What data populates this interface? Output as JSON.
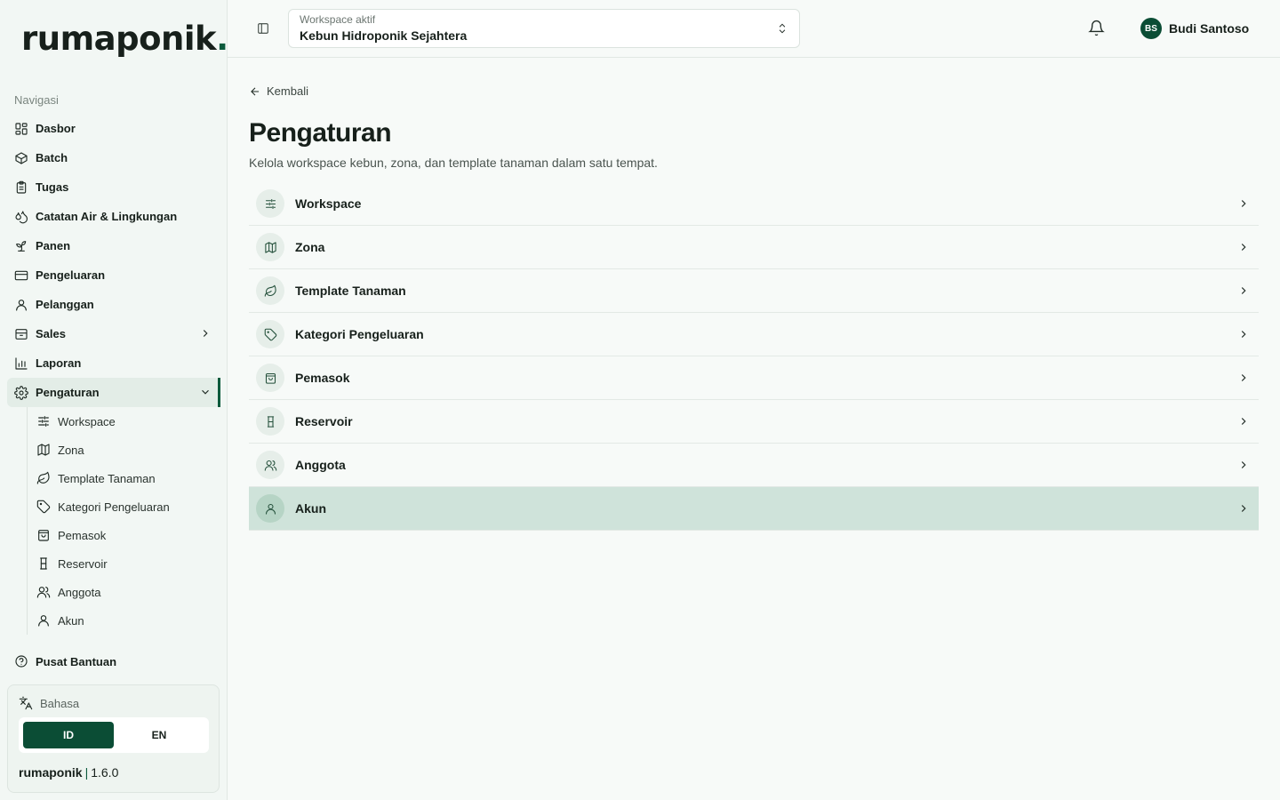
{
  "app": {
    "logo_text": "rumaponik",
    "logo_dot": ".",
    "version_name": "rumaponik",
    "version_sep": "|",
    "version_number": "1.6.0"
  },
  "sidebar": {
    "heading": "Navigasi",
    "items": [
      {
        "label": "Dasbor",
        "icon": "dashboard-icon"
      },
      {
        "label": "Batch",
        "icon": "box-icon"
      },
      {
        "label": "Tugas",
        "icon": "clipboard-icon"
      },
      {
        "label": "Catatan Air & Lingkungan",
        "icon": "droplets-icon"
      },
      {
        "label": "Panen",
        "icon": "sprout-icon"
      },
      {
        "label": "Pengeluaran",
        "icon": "credit-card-icon"
      },
      {
        "label": "Pelanggan",
        "icon": "user-icon"
      },
      {
        "label": "Sales",
        "icon": "archive-icon"
      },
      {
        "label": "Laporan",
        "icon": "bar-chart-icon"
      },
      {
        "label": "Pengaturan",
        "icon": "gear-icon"
      }
    ],
    "sub_items": [
      {
        "label": "Workspace",
        "icon": "sliders-icon"
      },
      {
        "label": "Zona",
        "icon": "map-icon"
      },
      {
        "label": "Template Tanaman",
        "icon": "leaf-icon"
      },
      {
        "label": "Kategori Pengeluaran",
        "icon": "tag-icon"
      },
      {
        "label": "Pemasok",
        "icon": "shopping-bag-icon"
      },
      {
        "label": "Reservoir",
        "icon": "container-icon"
      },
      {
        "label": "Anggota",
        "icon": "users-icon"
      },
      {
        "label": "Akun",
        "icon": "user-icon"
      }
    ],
    "help": "Pusat Bantuan",
    "language": {
      "label": "Bahasa",
      "options": [
        "ID",
        "EN"
      ],
      "selected": "ID"
    }
  },
  "topbar": {
    "workspace_label": "Workspace aktif",
    "workspace_value": "Kebun Hidroponik Sejahtera",
    "user_initials": "BS",
    "user_name": "Budi Santoso"
  },
  "main": {
    "back": "Kembali",
    "title": "Pengaturan",
    "subtitle": "Kelola workspace kebun, zona, dan template tanaman dalam satu tempat.",
    "rows": [
      {
        "label": "Workspace",
        "icon": "sliders-icon"
      },
      {
        "label": "Zona",
        "icon": "map-icon"
      },
      {
        "label": "Template Tanaman",
        "icon": "leaf-icon"
      },
      {
        "label": "Kategori Pengeluaran",
        "icon": "tag-icon"
      },
      {
        "label": "Pemasok",
        "icon": "shopping-bag-icon"
      },
      {
        "label": "Reservoir",
        "icon": "container-icon"
      },
      {
        "label": "Anggota",
        "icon": "users-icon"
      },
      {
        "label": "Akun",
        "icon": "user-icon"
      }
    ],
    "selected_row": "Akun"
  },
  "colors": {
    "brand": "#0b4d35",
    "selected_row": "#cfe3da",
    "sidebar_bg": "#f2f7f4"
  }
}
